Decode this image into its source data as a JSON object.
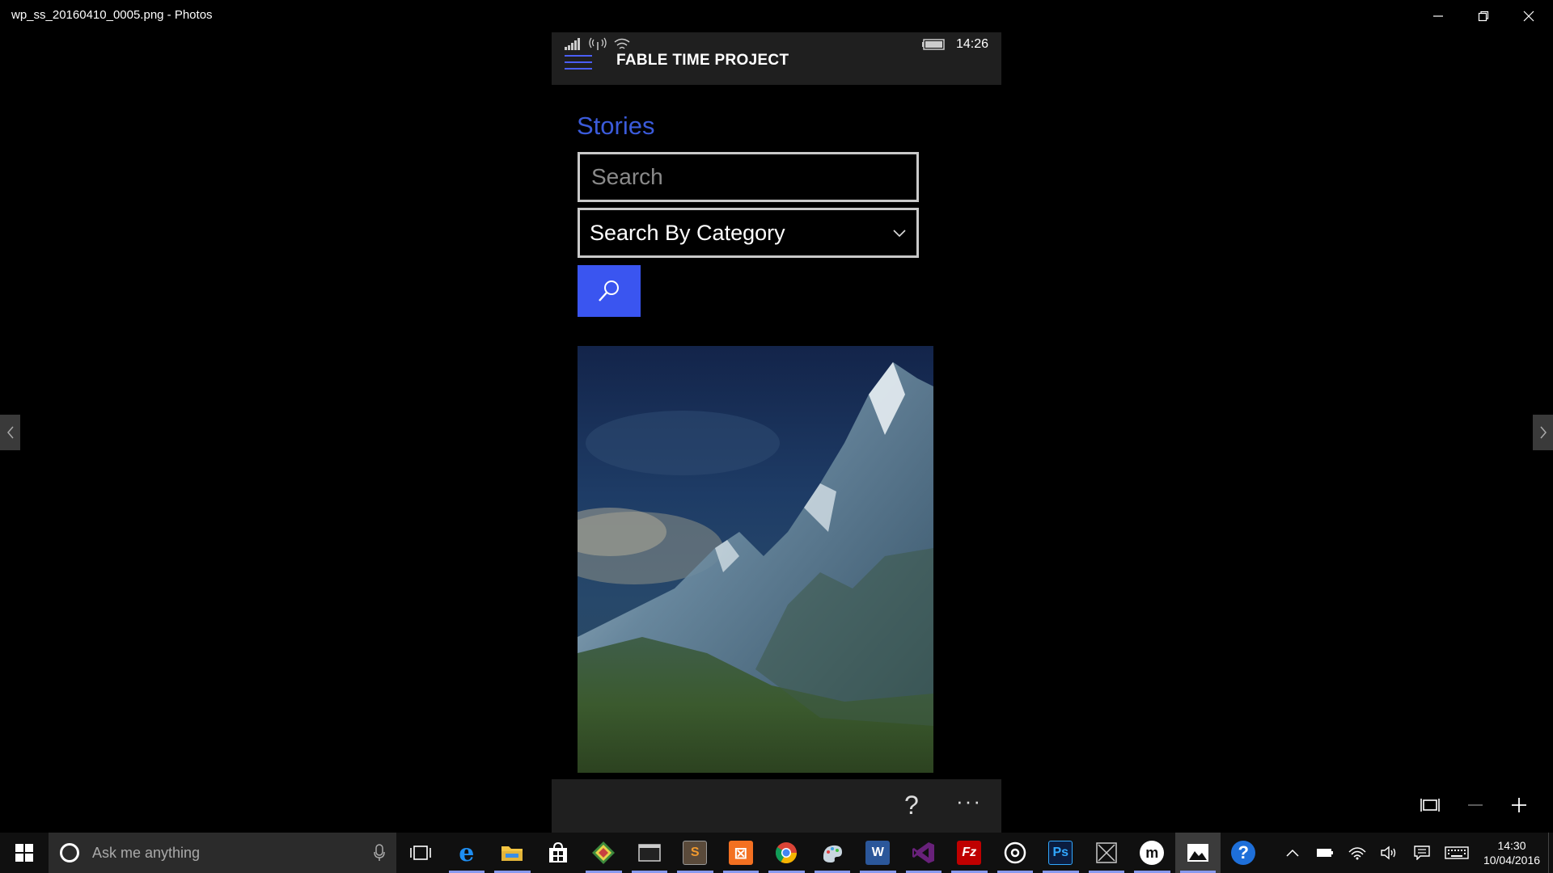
{
  "window": {
    "title": "wp_ss_20160410_0005.png - Photos"
  },
  "phone": {
    "status_time": "14:26",
    "app_title": "FABLE TIME PROJECT",
    "page_title": "Stories",
    "search_placeholder": "Search",
    "category_label": "Search By Category",
    "help_label": "?",
    "more_label": "···"
  },
  "taskbar": {
    "search_placeholder": "Ask me anything",
    "clock_time": "14:30",
    "clock_date": "10/04/2016",
    "apps": [
      {
        "name": "task-view",
        "label": ""
      },
      {
        "name": "edge",
        "label": "e"
      },
      {
        "name": "file-explorer",
        "label": ""
      },
      {
        "name": "store",
        "label": ""
      },
      {
        "name": "git",
        "label": ""
      },
      {
        "name": "terminal",
        "label": ""
      },
      {
        "name": "sublime",
        "label": "S"
      },
      {
        "name": "xampp",
        "label": "⊠"
      },
      {
        "name": "chrome",
        "label": ""
      },
      {
        "name": "paint",
        "label": ""
      },
      {
        "name": "word",
        "label": "W"
      },
      {
        "name": "visual-studio",
        "label": ""
      },
      {
        "name": "filezilla",
        "label": "Fz"
      },
      {
        "name": "media",
        "label": ""
      },
      {
        "name": "photoshop",
        "label": "Ps"
      },
      {
        "name": "snip",
        "label": ""
      },
      {
        "name": "m-app",
        "label": "m"
      },
      {
        "name": "photos",
        "label": ""
      },
      {
        "name": "help",
        "label": "?"
      }
    ]
  },
  "colors": {
    "accent": "#3a55f0",
    "title_blue": "#3b5bdb",
    "header_bg": "#1f1f1f"
  }
}
